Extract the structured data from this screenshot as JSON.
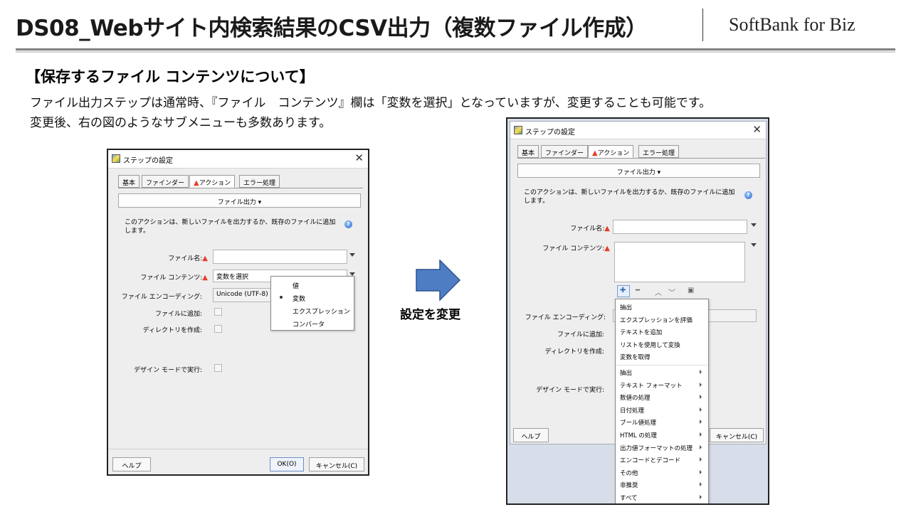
{
  "header": {
    "title": "DS08_Webサイト内検索結果のCSV出力（複数ファイル作成）",
    "brand": "SoftBank for Biz"
  },
  "section": {
    "heading": "【保存するファイル コンテンツについて】",
    "line1": "ファイル出力ステップは通常時、『ファイル　コンテンツ』欄は「変数を選択」となっていますが、変更することも可能です。",
    "line2": "変更後、右の図のようなサブメニューも多数あります。"
  },
  "arrow_label": "設定を変更",
  "dialog": {
    "title": "ステップの設定",
    "tabs": [
      "基本",
      "ファインダー",
      "アクション",
      "エラー処理"
    ],
    "action_button": "ファイル出力 ▾",
    "description_line1": "このアクションは、新しいファイルを出力するか、既存のファイルに追加",
    "description_line2": "します。",
    "file_name_label": "ファイル名:",
    "file_contents_label": "ファイル コンテンツ:",
    "encoding_label": "ファイル エンコーディング:",
    "append_label": "ファイルに追加:",
    "create_dir_label": "ディレクトリを作成:",
    "design_mode_label": "デザイン モードで実行:",
    "help_button": "ヘルプ",
    "ok_button": "OK(O)",
    "cancel_button": "キャンセル(C)",
    "cancel_button_short": "キャンセル(C)"
  },
  "left": {
    "contents_value": "変数を選択",
    "encoding_value": "Unicode (UTF-8)",
    "popup_items": [
      "値",
      "変数",
      "エクスプレッション",
      "コンバータ"
    ],
    "popup_selected_index": 1
  },
  "right": {
    "menu_group1": [
      "抽出",
      "エクスプレッションを評価",
      "テキストを追加",
      "リストを使用して変換",
      "変数を取得"
    ],
    "menu_group2": [
      "抽出",
      "テキスト フォーマット",
      "数値の処理",
      "日付処理",
      "ブール値処理",
      "HTML の処理",
      "出力値フォーマットの処理",
      "エンコードとデコード",
      "その他",
      "非推奨",
      "すべて"
    ]
  },
  "colors": {
    "warning": "#e53d2a",
    "arrow_fill": "#4e7dc4",
    "arrow_stroke": "#2f528f"
  }
}
